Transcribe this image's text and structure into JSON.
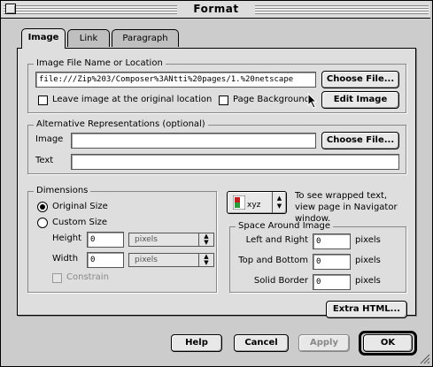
{
  "window": {
    "title": "Format"
  },
  "tabs": [
    {
      "label": "Image"
    },
    {
      "label": "Link"
    },
    {
      "label": "Paragraph"
    }
  ],
  "image_file": {
    "legend": "Image File Name or Location",
    "location_value": "file:///Zip%203/Composer%3ANtti%20pages/1.%20netscape",
    "choose_file_label": "Choose File...",
    "leave_original_label": "Leave image at the original location",
    "page_background_label": "Page Background",
    "edit_image_label": "Edit Image"
  },
  "alt_repr": {
    "legend": "Alternative Representations (optional)",
    "image_label": "Image",
    "image_value": "",
    "choose_file_label": "Choose File...",
    "text_label": "Text",
    "text_value": ""
  },
  "dimensions": {
    "legend": "Dimensions",
    "original_size_label": "Original Size",
    "custom_size_label": "Custom Size",
    "selected": "original",
    "height_label": "Height",
    "height_value": "0",
    "height_unit": "pixels",
    "width_label": "Width",
    "width_value": "0",
    "width_unit": "pixels",
    "constrain_label": "Constrain"
  },
  "wrap": {
    "popup_text": "xyz",
    "hint": "To see wrapped text, view page in Navigator window."
  },
  "space": {
    "legend": "Space Around Image",
    "left_right_label": "Left and Right",
    "left_right_value": "0",
    "top_bottom_label": "Top and Bottom",
    "top_bottom_value": "0",
    "solid_border_label": "Solid Border",
    "solid_border_value": "0",
    "unit": "pixels"
  },
  "extra_html_label": "Extra HTML...",
  "buttons": {
    "help": "Help",
    "cancel": "Cancel",
    "apply": "Apply",
    "ok": "OK"
  },
  "colors": {
    "window_bg": "#cccccc",
    "panel_bg": "#dedede",
    "field_bg": "#ffffff",
    "disabled_text": "#888888"
  }
}
